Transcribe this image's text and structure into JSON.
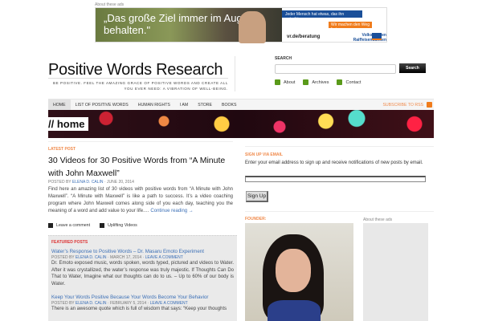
{
  "ad_top": {
    "label": "About these ads",
    "headline": "„Das große Ziel immer im Auge behalten.\"",
    "line1": "Jeder Mensch hat etwas, das ihn antreibt.",
    "line2": "Wir machen den Weg frei.",
    "url": "vr.de/beratung",
    "brand": "Volksbanken Raiffeisenbanken"
  },
  "header": {
    "title": "Positive Words Research",
    "tagline": "BE POSITIVE. FEEL THE AMAZING GRACE OF POSITIVE WORDS AND CREATE ALL YOU EVER NEED: A VIBRATION OF WELL-BEING."
  },
  "search": {
    "label": "SEARCH",
    "placeholder": "",
    "button": "Search"
  },
  "header_links": [
    {
      "label": "About"
    },
    {
      "label": "Archives"
    },
    {
      "label": "Contact"
    }
  ],
  "nav": {
    "items": [
      "HOME",
      "LIST OF POSITIVE WORDS",
      "HUMAN RIGHTS",
      "I AM",
      "STORE",
      "BOOKS"
    ],
    "rss": "SUBSCRIBE TO RSS"
  },
  "hero": {
    "label": "// home"
  },
  "latest": {
    "kicker": "LATEST POST",
    "title": "30 Videos for 30 Positive Words from “A Minute with John Maxwell”",
    "posted_by": "POSTED BY",
    "author": "ELENA D. CALIN",
    "date": "· JUNE 20, 2014",
    "excerpt": "Find here an amazing list of 30 videos with positive words from “A Minute with John Maxwell”. “A Minute with Maxwell” is like a path to success. It’s a video coaching program where John Maxwell comes along side of you each day, teaching you the meaning of a word and add value to your life.…",
    "continue": "Continue reading →",
    "comment": "Leave a comment",
    "category": "Uplifting Videos"
  },
  "featured": {
    "kicker": "FEATURED POSTS",
    "posts": [
      {
        "title": "Water’s Response to Positive Words – Dr. Masaru Emoto Experiment",
        "posted_by": "POSTED BY",
        "author": "ELENA D. CALIN",
        "date": "· MARCH 17, 2014 ·",
        "comment": "LEAVE A COMMENT",
        "excerpt": "Dr. Emoto exposed music, words spoken, words typed, pictured and videos to Water. After it was crystallized, the water’s response was truly majestic. If Thoughts Can Do That to Water, Imagine what our thoughts can do to us. – Up to 60% of our body is Water."
      },
      {
        "title": "Keep Your Words Positive Because Your Words Become Your Behavior",
        "posted_by": "POSTED BY",
        "author": "ELENA D. CALIN",
        "date": "· FEBRUARY 5, 2014 ·",
        "comment": "LEAVE A COMMENT",
        "excerpt": "There is an awesome quote which is full of wisdom that says: “Keep your thoughts"
      }
    ]
  },
  "signup": {
    "kicker": "SIGN UP VIA EMAIL",
    "text": "Enter your email address to sign up and receive notifications of new posts by email.",
    "value": "",
    "button": "Sign Up"
  },
  "founder": {
    "kicker": "FOUNDER:"
  },
  "ad_side": {
    "label": "About these ads"
  }
}
